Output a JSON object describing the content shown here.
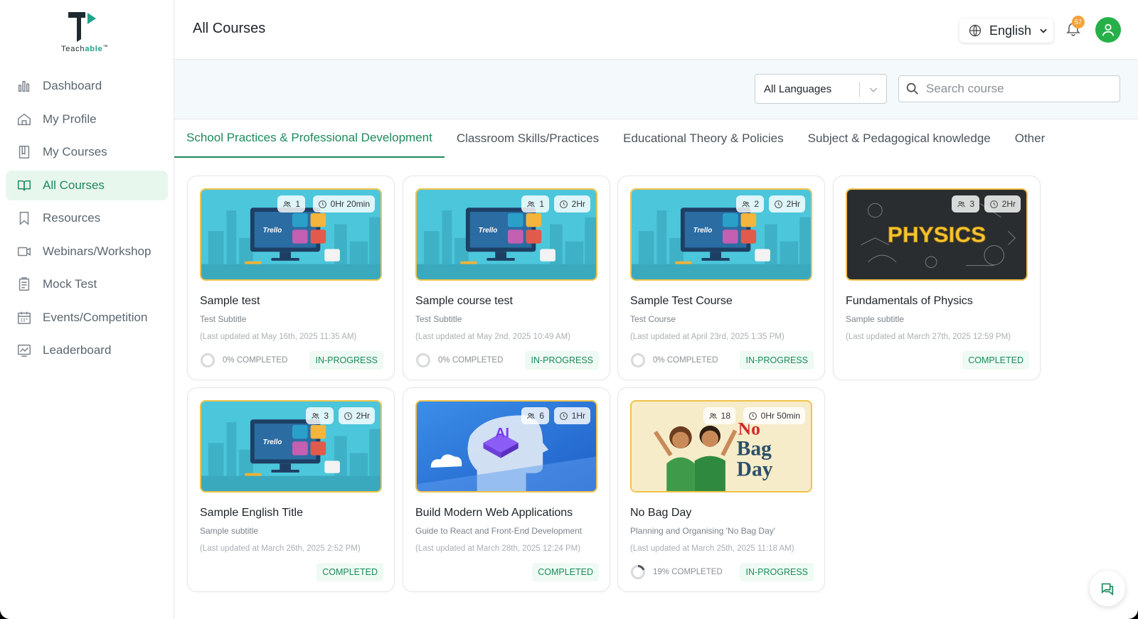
{
  "brand": {
    "name_prefix": "Teach",
    "name_suffix": "able",
    "tm": "™"
  },
  "sidebar": {
    "items": [
      {
        "label": "Dashboard",
        "icon": "bar-chart-icon"
      },
      {
        "label": "My Profile",
        "icon": "home-icon"
      },
      {
        "label": "My Courses",
        "icon": "book-icon"
      },
      {
        "label": "All Courses",
        "icon": "open-book-icon",
        "active": true
      },
      {
        "label": "Resources",
        "icon": "bookmark-icon"
      },
      {
        "label": "Webinars/Workshop",
        "icon": "video-icon"
      },
      {
        "label": "Mock Test",
        "icon": "clipboard-icon"
      },
      {
        "label": "Events/Competition",
        "icon": "calendar-icon"
      },
      {
        "label": "Leaderboard",
        "icon": "chart-board-icon"
      }
    ]
  },
  "header": {
    "title": "All Courses",
    "language": "English",
    "notification_count": "57"
  },
  "toolbar": {
    "language_filter": "All Languages",
    "search_placeholder": "Search course"
  },
  "tabs": [
    {
      "label": "School Practices & Professional Development",
      "active": true
    },
    {
      "label": "Classroom Skills/Practices"
    },
    {
      "label": "Educational Theory & Policies"
    },
    {
      "label": "Subject & Pedagogical knowledge"
    },
    {
      "label": "Other"
    }
  ],
  "courses": [
    {
      "title": "Sample test",
      "subtitle": "Test Subtitle",
      "updated": "(Last updated at May 16th, 2025 11:35 AM)",
      "learners": "1",
      "duration": "0Hr 20min",
      "progress_label": "0% COMPLETED",
      "progress": 0,
      "status": "IN-PROGRESS",
      "thumb": "trello"
    },
    {
      "title": "Sample course test",
      "subtitle": "Test Subtitle",
      "updated": "(Last updated at May 2nd, 2025 10:49 AM)",
      "learners": "1",
      "duration": "2Hr",
      "progress_label": "0% COMPLETED",
      "progress": 0,
      "status": "IN-PROGRESS",
      "thumb": "trello"
    },
    {
      "title": "Sample Test Course",
      "subtitle": "Test Course",
      "updated": "(Last updated at April 23rd, 2025 1:35 PM)",
      "learners": "2",
      "duration": "2Hr",
      "progress_label": "0% COMPLETED",
      "progress": 0,
      "status": "IN-PROGRESS",
      "thumb": "trello"
    },
    {
      "title": "Fundamentals of Physics",
      "subtitle": "Sample subtitle",
      "updated": "(Last updated at March 27th, 2025 12:59 PM)",
      "learners": "3",
      "duration": "2Hr",
      "progress_label": "",
      "progress": null,
      "status": "COMPLETED",
      "thumb": "physics",
      "thumb_text": "PHYSICS"
    },
    {
      "title": "Sample English Title",
      "subtitle": "Sample subtitle",
      "updated": "(Last updated at March 26th, 2025 2:52 PM)",
      "learners": "3",
      "duration": "2Hr",
      "progress_label": "",
      "progress": null,
      "status": "COMPLETED",
      "thumb": "trello"
    },
    {
      "title": "Build Modern Web Applications",
      "subtitle": "Guide to React and Front-End Development",
      "updated": "(Last updated at March 28th, 2025 12:24 PM)",
      "learners": "6",
      "duration": "1Hr",
      "progress_label": "",
      "progress": null,
      "status": "COMPLETED",
      "thumb": "ai",
      "thumb_text": "AI"
    },
    {
      "title": "No Bag Day",
      "subtitle": "Planning and Organising 'No Bag Day'",
      "updated": "(Last updated at March 25th, 2025 11:18 AM)",
      "learners": "18",
      "duration": "0Hr 50min",
      "progress_label": "19% COMPLETED",
      "progress": 0.19,
      "status": "IN-PROGRESS",
      "thumb": "nobag",
      "thumb_text": "No Bag Day"
    }
  ],
  "thumb_text": {
    "trello": "Trello"
  },
  "colors": {
    "accent": "#1d8a5b",
    "active_bg": "#e8f7ee",
    "badge": "#f2a33a",
    "thumb_border": "#f0c24a"
  }
}
